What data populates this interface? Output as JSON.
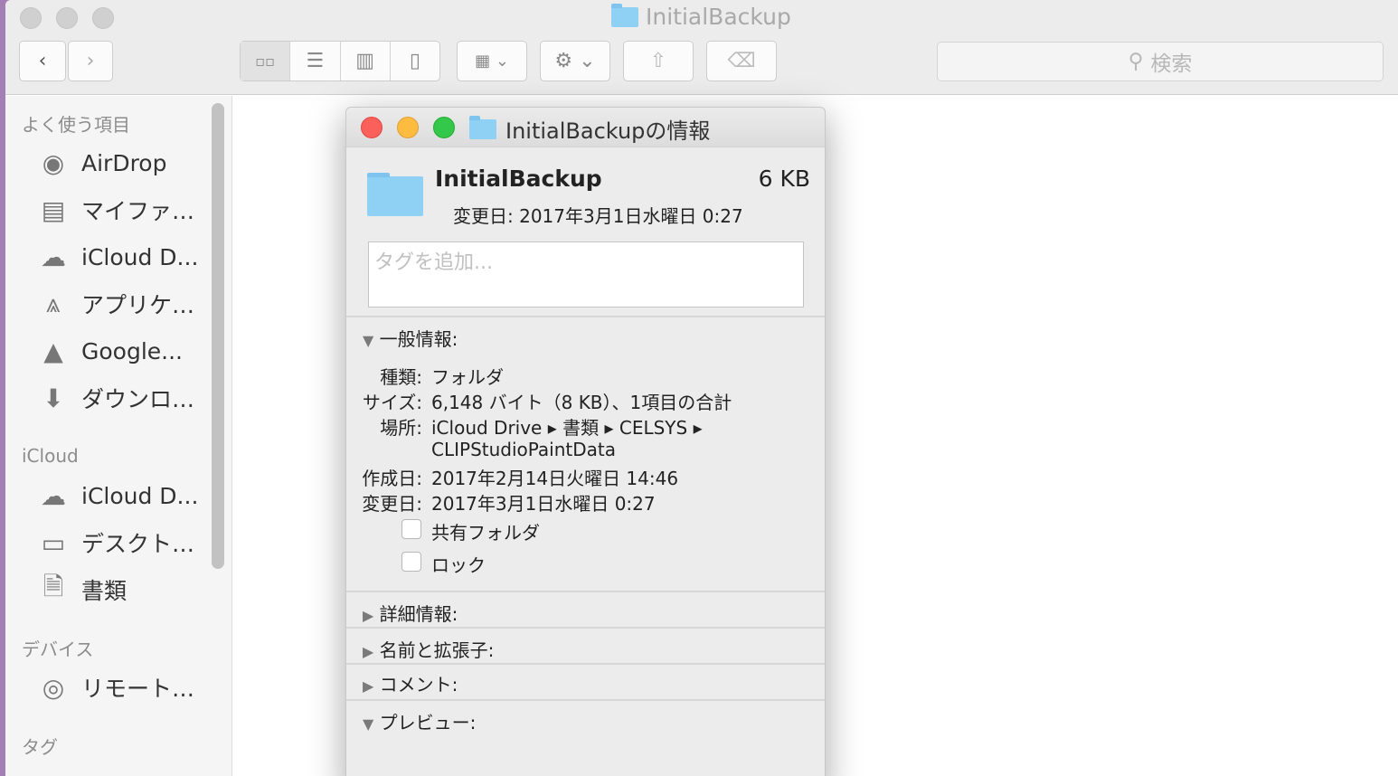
{
  "window": {
    "title": "InitialBackup"
  },
  "search": {
    "placeholder": "検索"
  },
  "sidebar": {
    "sections": [
      {
        "header": "よく使う項目",
        "items": [
          "AirDrop",
          "マイファ…",
          "iCloud D...",
          "アプリケ…",
          "Google...",
          "ダウンロ…"
        ]
      },
      {
        "header": "iCloud",
        "items": [
          "iCloud D...",
          "デスクト…",
          "書類"
        ]
      },
      {
        "header": "デバイス",
        "items": [
          "リモート…"
        ]
      },
      {
        "header": "タグ",
        "items": []
      }
    ]
  },
  "info": {
    "title": "InitialBackupの情報",
    "name": "InitialBackup",
    "size": "6 KB",
    "modified_header": "変更日: 2017年3月1日水曜日 0:27",
    "tags_placeholder": "タグを追加...",
    "general": {
      "label": "一般情報:",
      "kind_label": "種類:",
      "kind": "フォルダ",
      "size_label": "サイズ:",
      "size": "6,148 バイト（8 KB）、1項目の合計",
      "where_label": "場所:",
      "where": "iCloud Drive ▸ 書類 ▸ CELSYS ▸",
      "where2": "CLIPStudioPaintData",
      "created_label": "作成日:",
      "created": "2017年2月14日火曜日 14:46",
      "modified_label": "変更日:",
      "modified": "2017年3月1日水曜日 0:27",
      "shared": "共有フォルダ",
      "locked": "ロック"
    },
    "sections": [
      "詳細情報:",
      "名前と拡張子:",
      "コメント:",
      "プレビュー:"
    ]
  }
}
